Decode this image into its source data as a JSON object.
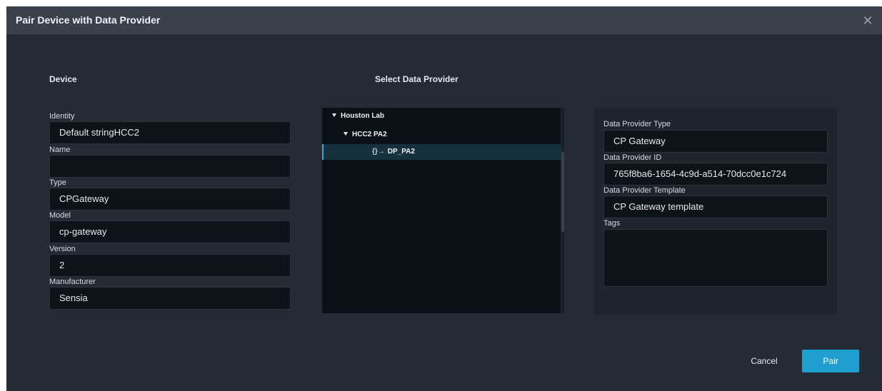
{
  "dialog": {
    "title": "Pair Device with Data Provider",
    "close_icon": "close-icon"
  },
  "device": {
    "heading": "Device",
    "fields": [
      {
        "label": "Identity",
        "value": "Default stringHCC2"
      },
      {
        "label": "Name",
        "value": ""
      },
      {
        "label": "Type",
        "value": "CPGateway"
      },
      {
        "label": "Model",
        "value": "cp-gateway"
      },
      {
        "label": "Version",
        "value": "2"
      },
      {
        "label": "Manufacturer",
        "value": "Sensia"
      }
    ]
  },
  "provider_select": {
    "heading": "Select Data Provider",
    "tree": [
      {
        "label": "Houston Lab",
        "level": 0,
        "expanded": true,
        "selected": false
      },
      {
        "label": "HCC2 PA2",
        "level": 1,
        "expanded": true,
        "selected": false
      },
      {
        "label": "DP_PA2",
        "level": 2,
        "icon": "data-provider-icon",
        "selected": true
      }
    ]
  },
  "provider_details": {
    "type_label": "Data Provider Type",
    "type_value": "CP Gateway",
    "id_label": "Data Provider ID",
    "id_value": "765f8ba6-1654-4c9d-a514-70dcc0e1c724",
    "template_label": "Data Provider Template",
    "template_value": "CP Gateway template",
    "tags_label": "Tags",
    "tags_value": ""
  },
  "actions": {
    "cancel_label": "Cancel",
    "pair_label": "Pair"
  },
  "colors": {
    "accent": "#1e9fcf",
    "dialog_bg": "#252b34",
    "titlebar_bg": "#3a414b",
    "field_bg": "#0e1319"
  }
}
